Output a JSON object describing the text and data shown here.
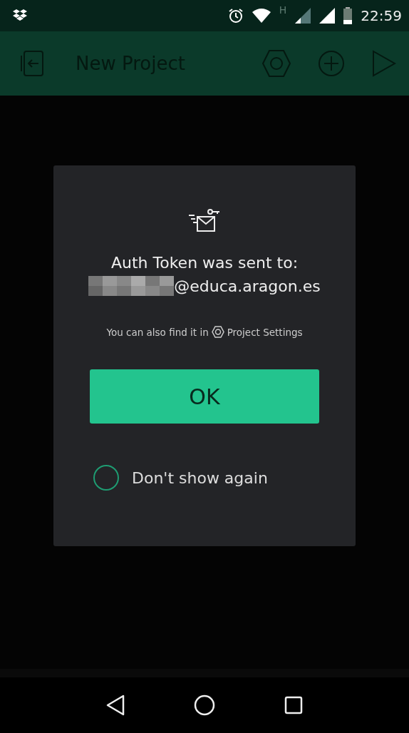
{
  "status_bar": {
    "network_type": "H",
    "time": "22:59"
  },
  "toolbar": {
    "title": "New Project"
  },
  "dialog": {
    "heading": "Auth Token was sent to:",
    "email": "@educa.aragon.es",
    "hint_before": "You can also find it in",
    "hint_link": "Project Settings",
    "ok_button": "OK",
    "dont_show": {
      "label": "Don't show again",
      "checked": false
    }
  }
}
